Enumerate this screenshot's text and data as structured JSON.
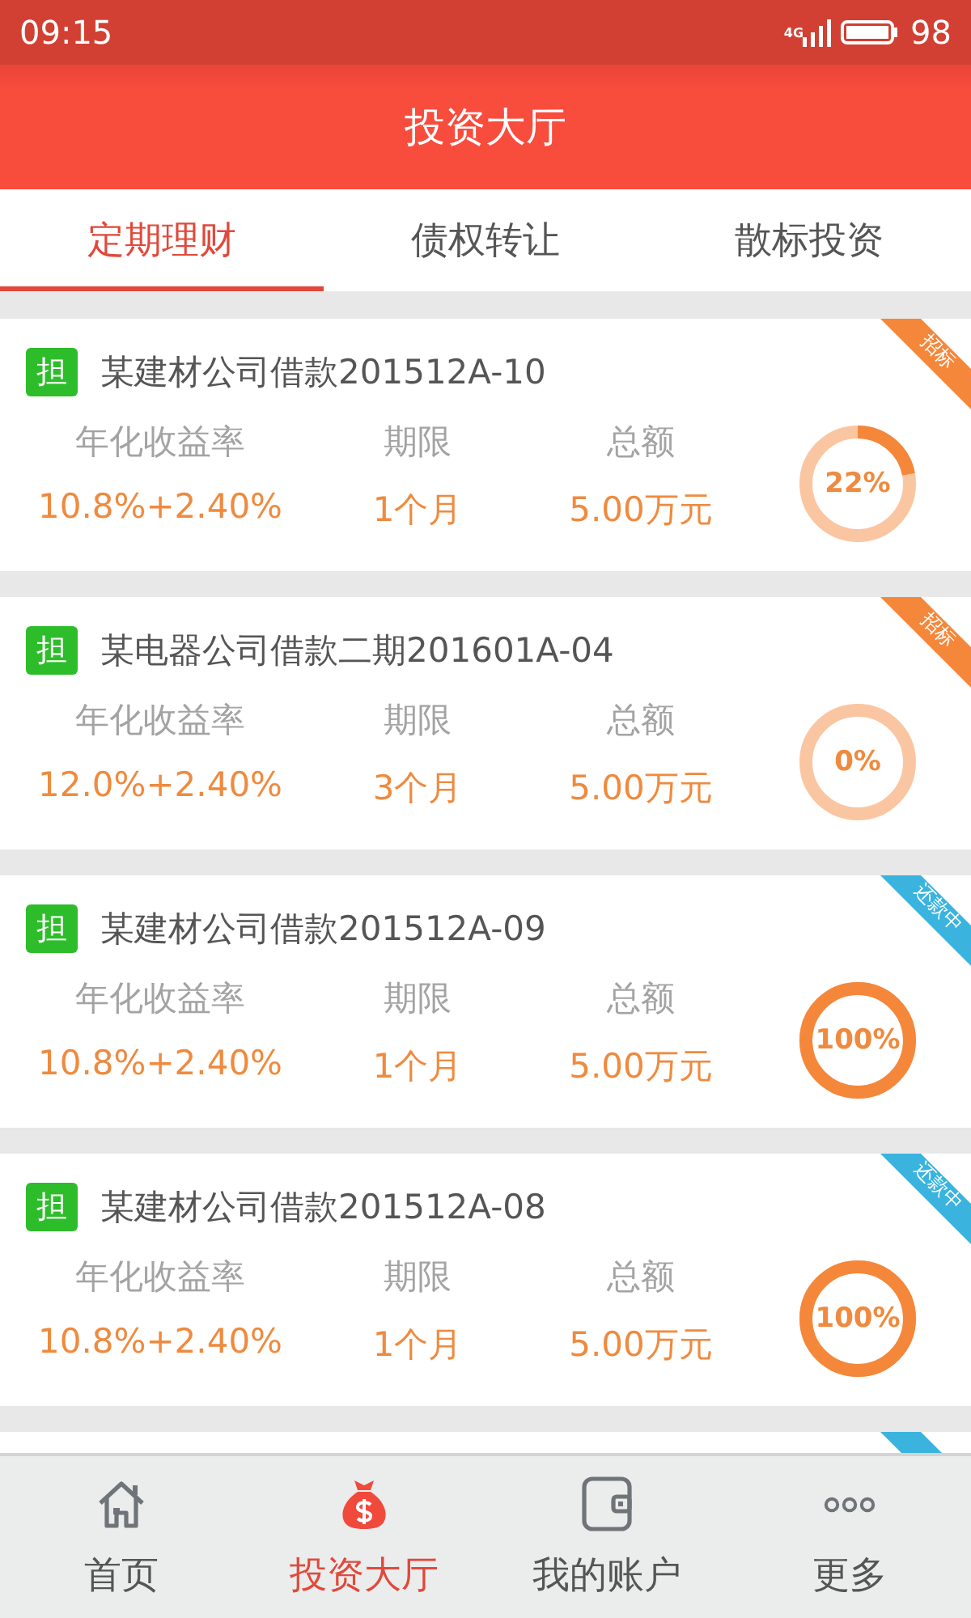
{
  "status_bar": {
    "time": "09:15",
    "network": "4G",
    "battery": "98"
  },
  "header": {
    "title": "投资大厅"
  },
  "tabs": [
    {
      "label": "定期理财",
      "selected": true
    },
    {
      "label": "债权转让",
      "selected": false
    },
    {
      "label": "散标投资",
      "selected": false
    }
  ],
  "loans": [
    {
      "badge": "担",
      "title": "某建材公司借款201512A-10",
      "kind": "bidding",
      "ribbon": "招标",
      "labels": [
        "年化收益率",
        "期限",
        "总额"
      ],
      "rate": "10.8%+2.40%",
      "term": "1个月",
      "amount": "5.00万元",
      "level": 0.22,
      "percent": "22%"
    },
    {
      "badge": "担",
      "title": "某电器公司借款二期201601A-04",
      "kind": "bidding",
      "ribbon": "招标",
      "labels": [
        "年化收益率",
        "期限",
        "总额"
      ],
      "rate": "12.0%+2.40%",
      "term": "3个月",
      "amount": "5.00万元",
      "level": 0,
      "percent": "0%"
    },
    {
      "badge": "担",
      "title": "某建材公司借款201512A-09",
      "kind": "repaying",
      "ribbon": "还款中",
      "labels": [
        "年化收益率",
        "期限",
        "总额"
      ],
      "rate": "10.8%+2.40%",
      "term": "1个月",
      "amount": "5.00万元",
      "level": 1,
      "percent": "100%"
    },
    {
      "badge": "担",
      "title": "某建材公司借款201512A-08",
      "kind": "repaying",
      "ribbon": "还款中",
      "labels": [
        "年化收益率",
        "期限",
        "总额"
      ],
      "rate": "10.8%+2.40%",
      "term": "1个月",
      "amount": "5.00万元",
      "level": 1,
      "percent": "100%"
    }
  ],
  "partial_card": {
    "kind": "repaying"
  },
  "bottom_nav": [
    {
      "kind": "home",
      "label": "首页",
      "selected": false
    },
    {
      "kind": "moneybag",
      "label": "投资大厅",
      "selected": true
    },
    {
      "kind": "wallet",
      "label": "我的账户",
      "selected": false
    },
    {
      "kind": "more",
      "label": "更多",
      "selected": false
    }
  ]
}
